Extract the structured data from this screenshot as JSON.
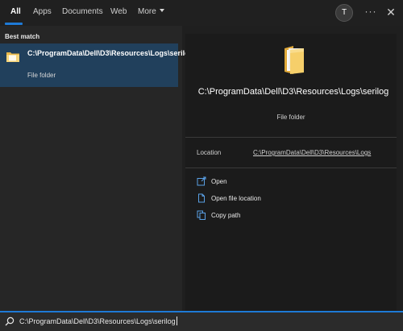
{
  "tabs": [
    {
      "label": "All",
      "active": true
    },
    {
      "label": "Apps"
    },
    {
      "label": "Documents"
    },
    {
      "label": "Web"
    },
    {
      "label": "More"
    }
  ],
  "user": {
    "initial": "T"
  },
  "more_options": "···",
  "close": "✕",
  "left": {
    "section_title": "Best match",
    "best_match": {
      "title": "C:\\ProgramData\\Dell\\D3\\Resources\\Logs\\serilog",
      "subtitle": "File folder",
      "icon": "folder-icon"
    }
  },
  "details": {
    "title": "C:\\ProgramData\\Dell\\D3\\Resources\\Logs\\serilog",
    "subtitle": "File folder",
    "location_label": "Location",
    "location_value": "C:\\ProgramData\\Dell\\D3\\Resources\\Logs",
    "actions": [
      {
        "label": "Open",
        "icon": "open-icon"
      },
      {
        "label": "Open file location",
        "icon": "file-location-icon"
      },
      {
        "label": "Copy path",
        "icon": "copy-icon"
      }
    ]
  },
  "search": {
    "value": "C:\\ProgramData\\Dell\\D3\\Resources\\Logs\\serilog",
    "icon": "search-icon"
  },
  "colors": {
    "accent": "#1e7ad6",
    "selection": "#21405c",
    "folder": "#f2c14e"
  }
}
